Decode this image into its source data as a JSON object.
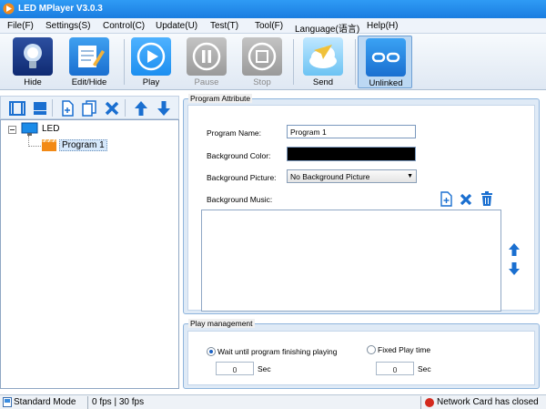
{
  "window": {
    "title": "LED MPlayer V3.0.3"
  },
  "menu": [
    "File(F)",
    "Settings(S)",
    "Control(C)",
    "Update(U)",
    "Test(T)",
    "Tool(F)",
    "Language(语言)",
    "Help(H)"
  ],
  "toolbar": {
    "hide": "Hide",
    "edit_hide": "Edit/Hide",
    "play": "Play",
    "pause": "Pause",
    "stop": "Stop",
    "send": "Send",
    "unlinked": "Unlinked"
  },
  "tree": {
    "root": "LED",
    "program": "Program 1"
  },
  "program_attribute": {
    "title": "Program Attribute",
    "name_label": "Program Name:",
    "name_value": "Program 1",
    "bg_color_label": "Background Color:",
    "bg_color_value": "#000000",
    "bg_picture_label": "Background Picture:",
    "bg_picture_value": "No Background Picture",
    "bg_music_label": "Background Music:"
  },
  "play_management": {
    "title": "Play management",
    "wait_label": "Wait until program finishing playing",
    "wait_checked": true,
    "wait_value": "0",
    "wait_unit": "Sec",
    "fixed_label": "Fixed Play time",
    "fixed_checked": false,
    "fixed_value": "0",
    "fixed_unit": "Sec"
  },
  "status": {
    "mode": "Standard Mode",
    "fps": "0 fps | 30 fps",
    "network": "Network Card has closed"
  },
  "colors": {
    "title_bar": "#1f88ea",
    "play_blue": "#1c8ff0",
    "disabled_gray": "#9a9a9a",
    "network_status_red": "#d42a1e",
    "icon_blue": "#1a6fd0"
  }
}
